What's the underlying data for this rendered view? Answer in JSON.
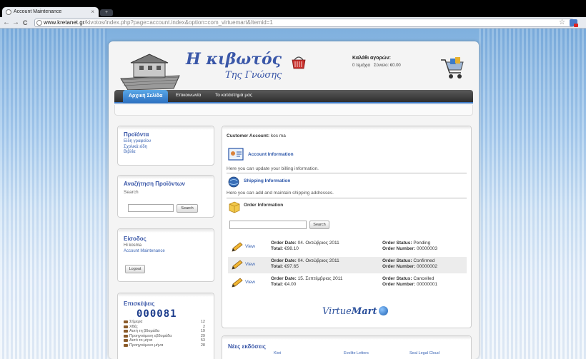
{
  "browser": {
    "tab_title": "Account Maintenance",
    "tab_close": "×",
    "url_domain": "www.kretanet.gr",
    "url_path": "/kivotos/index.php?page=account.index&option=com_virtuemart&Itemid=1",
    "back": "←",
    "forward": "→",
    "reload": "C",
    "star": "☆"
  },
  "header": {
    "title": "Η κιβωτός",
    "subtitle": "Της Γνώσης",
    "cart_title": "Καλάθι αγορών:",
    "cart_items": "0 τεμάχια",
    "cart_total": "Σύνολο: €0.00"
  },
  "menu": {
    "items": [
      "Αρχική Σελίδα",
      "Επικοινωνία",
      "Το κατάστημά μας"
    ]
  },
  "sidebar": {
    "products": {
      "title": "Προϊόντα",
      "links": [
        "Είδη γραφείου",
        "Σχολικά είδη",
        "Βιβλία"
      ]
    },
    "search": {
      "title": "Αναζήτηση Προϊόντων",
      "label": "Search",
      "button": "Search"
    },
    "login": {
      "title": "Είσοδος",
      "greeting": "Hi kosma",
      "link": "Account Maintenance",
      "button": "Logout"
    },
    "visits": {
      "title": "Επισκέψεις",
      "counter": "000081",
      "rows": [
        {
          "label": "Σήμερα",
          "value": "12"
        },
        {
          "label": "Χθές",
          "value": "2"
        },
        {
          "label": "Αυτή τη βδομάδα",
          "value": "19"
        },
        {
          "label": "Προηγούμενη εβδομάδα",
          "value": "29"
        },
        {
          "label": "Αυτό το μήνα",
          "value": "53"
        },
        {
          "label": "Προηγούμενο μήνα",
          "value": "28"
        }
      ]
    }
  },
  "main": {
    "customer_label": "Customer Account:",
    "customer_name": "kos ma",
    "account_title": "Account Information",
    "account_desc": "Here you can update your billing information.",
    "shipping_title": "Shipping Information",
    "shipping_desc": "Here you can add and maintain shipping addresses.",
    "order_title": "Order Information",
    "search_button": "Search",
    "view_label": "View",
    "orders": [
      {
        "date_label": "Order Date:",
        "date": "04. Οκτώβριος 2011",
        "total_label": "Total:",
        "total": "€98.10",
        "status_label": "Order Status:",
        "status": "Pending",
        "number_label": "Order Number:",
        "number": "00000003"
      },
      {
        "date_label": "Order Date:",
        "date": "04. Οκτώβριος 2011",
        "total_label": "Total:",
        "total": "€97.65",
        "status_label": "Order Status:",
        "status": "Confirmed",
        "number_label": "Order Number:",
        "number": "00000002"
      },
      {
        "date_label": "Order Date:",
        "date": "15. Σεπτέμβριος 2011",
        "total_label": "Total:",
        "total": "€4.00",
        "status_label": "Order Status:",
        "status": "Cancelled",
        "number_label": "Order Number:",
        "number": "00000001"
      }
    ],
    "vm_logo_a": "Virtue",
    "vm_logo_b": "Mart"
  },
  "news": {
    "title": "Νέες εκδόσεις",
    "items": [
      "Kiwi",
      "Evolite Letters",
      "Seal Legal Cloud"
    ]
  },
  "colors": {
    "brand_blue": "#3a57a8",
    "menu_active": "#2b6fc0",
    "link": "#3a64b4"
  }
}
